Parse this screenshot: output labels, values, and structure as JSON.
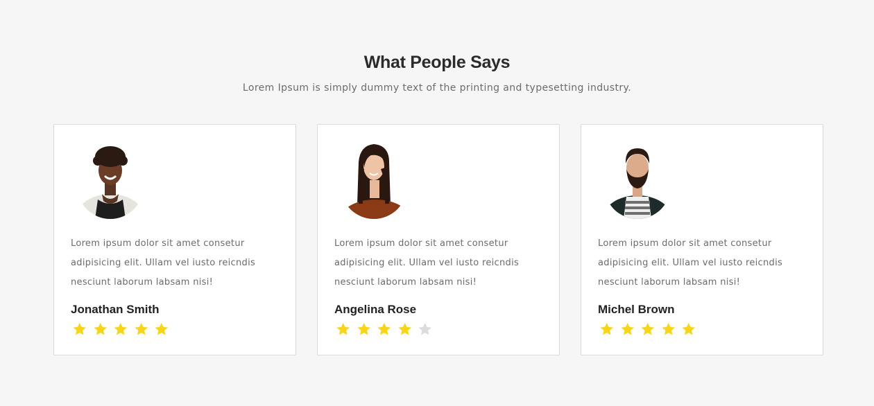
{
  "header": {
    "title": "What People Says",
    "subtitle": "Lorem Ipsum is simply dummy text of the printing and typesetting industry."
  },
  "testimonials": [
    {
      "quote": "Lorem ipsum dolor sit amet consetur adipisicing elit. Ullam vel iusto reicndis nesciunt laborum labsam nisi!",
      "name": "Jonathan Smith",
      "rating": 5,
      "rating_max": 5
    },
    {
      "quote": "Lorem ipsum dolor sit amet consetur adipisicing elit. Ullam vel iusto reicndis nesciunt laborum labsam nisi!",
      "name": "Angelina Rose",
      "rating": 4,
      "rating_max": 5
    },
    {
      "quote": "Lorem ipsum dolor sit amet consetur adipisicing elit. Ullam vel iusto reicndis nesciunt laborum labsam nisi!",
      "name": "Michel Brown",
      "rating": 5,
      "rating_max": 5
    }
  ],
  "colors": {
    "background": "#f6f6f6",
    "card": "#ffffff",
    "star_filled": "#f7d51b",
    "star_empty": "#dcdcdc"
  }
}
